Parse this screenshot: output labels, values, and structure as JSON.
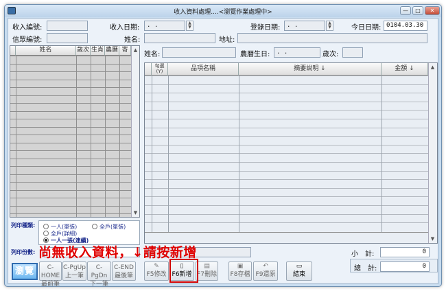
{
  "window": {
    "title": "收入資料處理....<瀏覽作業處理中>",
    "buttons": {
      "minimize": "—",
      "maximize": "□",
      "close": "✕"
    }
  },
  "header": {
    "income_no_label": "收入編號:",
    "income_date_label": "收入日期:",
    "income_date_value": " .  .",
    "record_date_label": "登錄日期:",
    "record_date_value": " .  .",
    "today_label": "今日日期:",
    "today_value": "0104.03.30",
    "believer_no_label": "信眾編號:",
    "name_label": "姓名:",
    "address_label": "地址:"
  },
  "left_grid": {
    "columns": [
      "姓名",
      "歲次",
      "生肖",
      "農曆",
      "寄"
    ]
  },
  "detail": {
    "name_label": "姓名:",
    "lunar_birth_label": "農曆生日:",
    "lunar_birth_value": " .  .",
    "age_label": "歲次:",
    "columns": [
      "勾選\n(Y)",
      "品項名稱",
      "摘要說明 ↓",
      "金額 ↓"
    ]
  },
  "print_options": {
    "type_label": "列印種類:",
    "options": [
      {
        "label": "一人(單張)",
        "selected": false
      },
      {
        "label": "全戶(單張)",
        "selected": false
      },
      {
        "label": "全戶(詳細)",
        "selected": false
      },
      {
        "label": "一人一張(連續)",
        "selected": true
      }
    ],
    "copies_label": "列印份數:"
  },
  "overlay_text": "尚無收入資料，↓請按新增",
  "totals": {
    "subtotal_label": "小　計:",
    "subtotal_value": "0",
    "total_label": "總　計:",
    "total_value": "0"
  },
  "toolbar": {
    "browse": "瀏覽",
    "buttons": [
      {
        "key": "C-HOME",
        "label": "最前筆",
        "icon": "",
        "active": false
      },
      {
        "key": "C-PgUp",
        "label": "上一筆",
        "icon": "",
        "active": false
      },
      {
        "key": "C-PgDn",
        "label": "下一筆",
        "icon": "",
        "active": false
      },
      {
        "key": "C-END",
        "label": "最後筆",
        "icon": "",
        "active": false
      },
      {
        "key": "F5修改",
        "label": "",
        "icon": "✎",
        "active": false
      },
      {
        "key": "F6新增",
        "label": "",
        "icon": "▯",
        "active": true
      },
      {
        "key": "F7刪除",
        "label": "",
        "icon": "▤",
        "active": false
      },
      {
        "key": "F8存檔",
        "label": "",
        "icon": "▣",
        "active": false
      },
      {
        "key": "F9還原",
        "label": "",
        "icon": "↶",
        "active": false
      },
      {
        "key": "結束",
        "label": "",
        "icon": "▭",
        "active": true
      }
    ]
  },
  "colors": {
    "highlight": "#d00000",
    "overlay": "#e00000",
    "label_blue": "#1a2a8c"
  }
}
